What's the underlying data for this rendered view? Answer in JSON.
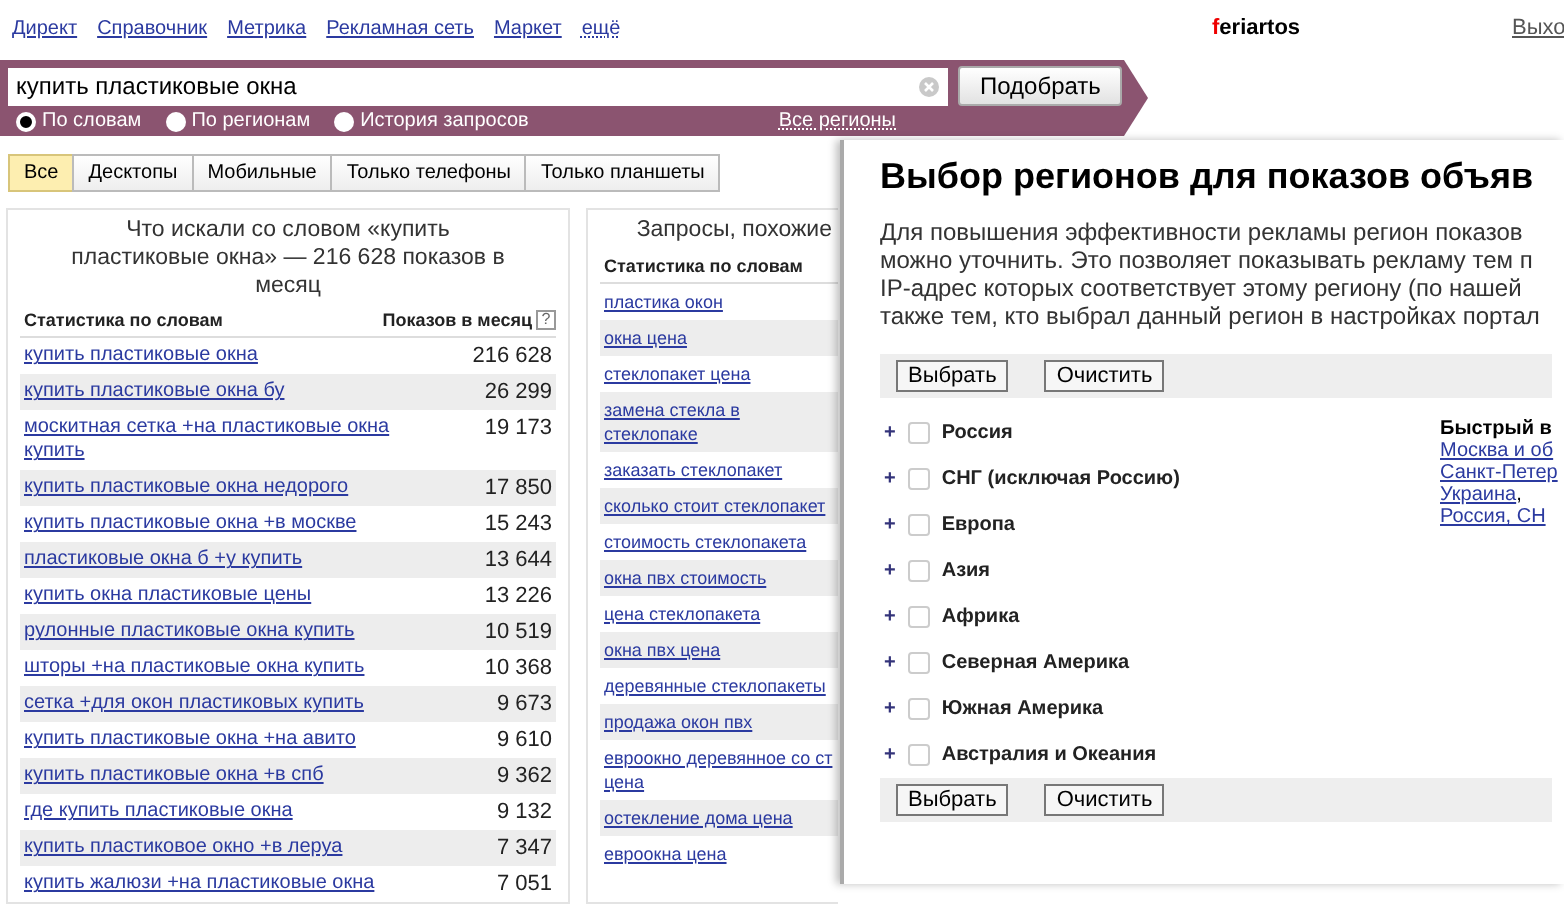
{
  "nav": {
    "links": [
      "Директ",
      "Справочник",
      "Метрика",
      "Рекламная сеть",
      "Маркет",
      "ещё"
    ],
    "user_first": "f",
    "user_rest": "eriartos",
    "logout": "Выхо"
  },
  "search": {
    "value": "купить пластиковые окна",
    "button": "Подобрать",
    "modes": [
      {
        "label": "По словам",
        "selected": true
      },
      {
        "label": "По регионам",
        "selected": false
      },
      {
        "label": "История запросов",
        "selected": false
      }
    ],
    "region_link": "Все регионы"
  },
  "device_tabs": [
    {
      "label": "Все",
      "selected": true
    },
    {
      "label": "Десктопы",
      "selected": false
    },
    {
      "label": "Мобильные",
      "selected": false
    },
    {
      "label": "Только телефоны",
      "selected": false
    },
    {
      "label": "Только планшеты",
      "selected": false
    }
  ],
  "left_panel": {
    "title": "Что искали со словом «купить пластиковые окна» — 216 628 показов в месяц",
    "columns": [
      "Статистика по словам",
      "Показов в месяц"
    ],
    "help": "?",
    "rows": [
      {
        "phrase": "купить пластиковые окна",
        "count": "216 628"
      },
      {
        "phrase": "купить пластиковые окна бу",
        "count": "26 299"
      },
      {
        "phrase": "москитная сетка +на пластиковые окна купить",
        "count": "19 173"
      },
      {
        "phrase": "купить пластиковые окна недорого",
        "count": "17 850"
      },
      {
        "phrase": "купить пластиковые окна +в москве",
        "count": "15 243"
      },
      {
        "phrase": "пластиковые окна б +у купить",
        "count": "13 644"
      },
      {
        "phrase": "купить окна пластиковые цены",
        "count": "13 226"
      },
      {
        "phrase": "рулонные пластиковые окна купить",
        "count": "10 519"
      },
      {
        "phrase": "шторы +на пластиковые окна купить",
        "count": "10 368"
      },
      {
        "phrase": "сетка +для окон пластиковых купить",
        "count": "9 673"
      },
      {
        "phrase": "купить пластиковые окна +на авито",
        "count": "9 610"
      },
      {
        "phrase": "купить пластиковые окна +в спб",
        "count": "9 362"
      },
      {
        "phrase": "где купить пластиковые окна",
        "count": "9 132"
      },
      {
        "phrase": "купить пластиковое окно +в леруа",
        "count": "7 347"
      },
      {
        "phrase": "купить жалюзи +на пластиковые окна",
        "count": "7 051"
      }
    ]
  },
  "right_panel": {
    "title": "Запросы, похожие",
    "column": "Статистика по словам",
    "rows": [
      {
        "phrase": "пластика окон"
      },
      {
        "phrase": "окна цена"
      },
      {
        "phrase": "стеклопакет цена"
      },
      {
        "phrase": "замена стекла в стеклопаке"
      },
      {
        "phrase": "заказать стеклопакет"
      },
      {
        "phrase": "сколько стоит стеклопакет"
      },
      {
        "phrase": "стоимость стеклопакета"
      },
      {
        "phrase": "окна пвх стоимость"
      },
      {
        "phrase": "цена стеклопакета"
      },
      {
        "phrase": "окна пвх цена"
      },
      {
        "phrase": "деревянные стеклопакеты"
      },
      {
        "phrase": "продажа окон пвх"
      },
      {
        "phrase": "евроокно деревянное со ст\nцена"
      },
      {
        "phrase": "остекление дома цена"
      },
      {
        "phrase": "евроокна цена"
      }
    ]
  },
  "dialog": {
    "title": "Выбор регионов для показов объяв",
    "text_lines": [
      "Для повышения эффективности рекламы регион показов",
      "можно уточнить. Это позволяет показывать рекламу тем п",
      "IP-адрес которых соответствует этому региону (по нашей",
      "также тем, кто выбрал данный регион в настройках портал"
    ],
    "buttons_top": [
      "Выбрать",
      "Очистить"
    ],
    "regions": [
      {
        "expander": "+",
        "name": "Россия",
        "checked": false
      },
      {
        "expander": "+",
        "name": "СНГ (исключая Россию)",
        "checked": false
      },
      {
        "expander": "+",
        "name": "Европа",
        "checked": false
      },
      {
        "expander": "+",
        "name": "Азия",
        "checked": false
      },
      {
        "expander": "+",
        "name": "Африка",
        "checked": false
      },
      {
        "expander": "+",
        "name": "Северная Америка",
        "checked": false
      },
      {
        "expander": "+",
        "name": "Южная Америка",
        "checked": false
      },
      {
        "expander": "+",
        "name": "Австралия и Океания",
        "checked": false
      }
    ],
    "quick": {
      "title": "Быстрый в",
      "links": [
        {
          "label": "Москва и об"
        },
        {
          "label": "Санкт-Петер"
        },
        {
          "label": "Украина",
          "after": ","
        },
        {
          "label": "Россия, СН"
        }
      ]
    },
    "buttons_bottom": [
      "Выбрать",
      "Очистить"
    ]
  }
}
